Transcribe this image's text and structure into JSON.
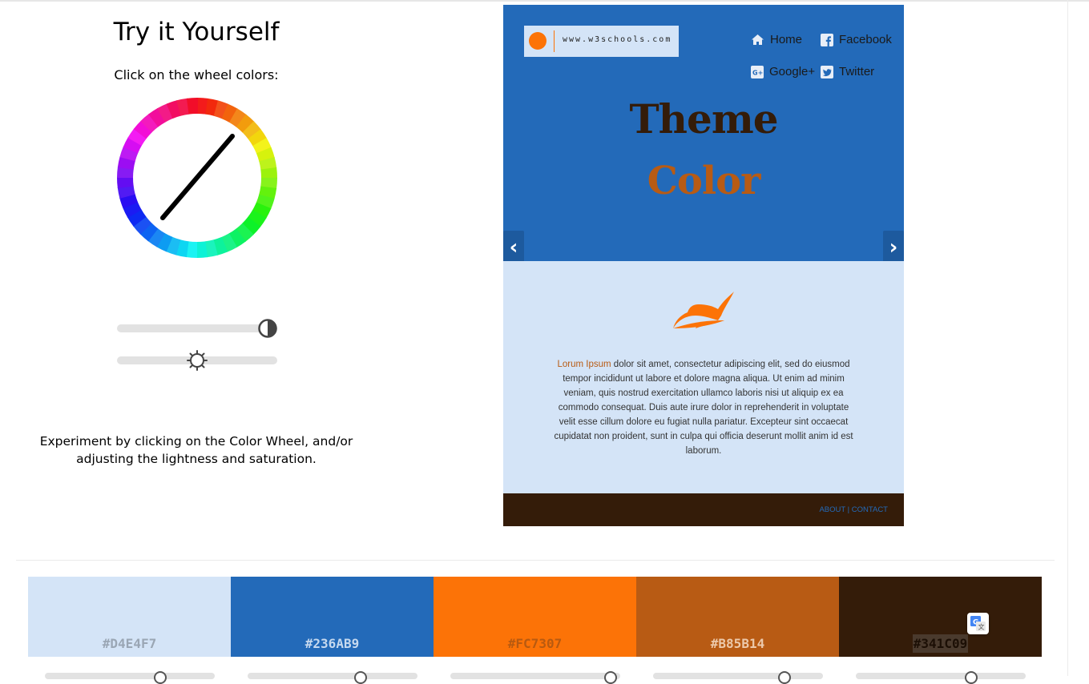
{
  "left": {
    "title": "Try it Yourself",
    "subtitle": "Click on the wheel colors:",
    "explain": "Experiment by clicking on the Color Wheel, and/or adjusting the lightness and saturation.",
    "saturation_level": 0.94,
    "lightness_level": 0.5
  },
  "preview": {
    "logo_text": "www.w3schools.com",
    "nav": {
      "home": "Home",
      "facebook": "Facebook",
      "google": "Google+",
      "twitter": "Twitter"
    },
    "hero_line1": "Theme",
    "hero_line2": "Color",
    "prev_arrow": "‹",
    "next_arrow": "›",
    "lorem_highlight": "Lorum Ipsum",
    "lorem_rest": " dolor sit amet, consectetur adipiscing elit, sed do eiusmod tempor incididunt ut labore et dolore magna aliqua. Ut enim ad minim veniam, quis nostrud exercitation ullamco laboris nisi ut aliquip ex ea commodo consequat. Duis aute irure dolor in reprehenderit in voluptate velit esse cillum dolore eu fugiat nulla pariatur. Excepteur sint occaecat cupidatat non proident, sunt in culpa qui officia deserunt mollit anim id est laborum.",
    "footer_about": "ABOUT",
    "footer_sep": " | ",
    "footer_contact": "CONTACT"
  },
  "palette": [
    {
      "hex": "#D4E4F7",
      "color": "#D4E4F7",
      "text_color": "#9aa6b4"
    },
    {
      "hex": "#236AB9",
      "color": "#236AB9",
      "text_color": "#c6d9ef"
    },
    {
      "hex": "#FC7307",
      "color": "#FC7307",
      "text_color": "#b85a10"
    },
    {
      "hex": "#B85B14",
      "color": "#B85B14",
      "text_color": "#ecc9ab"
    },
    {
      "hex": "#341C09",
      "color": "#341C09",
      "text_color": "#1c0f05"
    }
  ],
  "colors": {
    "hero_bg": "#236AB9",
    "content_bg": "#D4E4F7",
    "accent": "#FC7307",
    "secondary": "#B85B14",
    "dark": "#341C09"
  },
  "icons": {
    "wheel": "color-wheel-icon",
    "saturation": "contrast-icon",
    "lightness": "brightness-icon",
    "translate": "google-translate-icon"
  }
}
